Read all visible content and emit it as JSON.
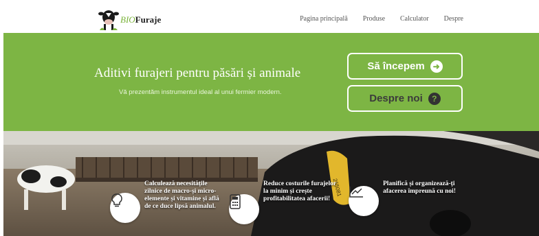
{
  "brand": {
    "bio": "BIO",
    "rest": "Furaje"
  },
  "nav": [
    "Pagina principală",
    "Produse",
    "Calculator",
    "Despre"
  ],
  "hero": {
    "title": "Aditivi furajeri pentru păsări și animale",
    "subtitle": "Vă prezentăm instrumentul ideal al unui fermier modern.",
    "btn_start": "Să începem",
    "btn_about": "Despre noi",
    "btn_start_icon": "arrow-right-icon",
    "btn_about_icon": "question-icon"
  },
  "features": [
    {
      "icon": "lightbulb-icon",
      "text": "Calculează necesitățile zilnice de macro-și micro-elemente și vitamine și află de ce duce lipsă animalul."
    },
    {
      "icon": "calculator-icon",
      "text": "Reduce costurile furajelor la minim și crește profitabilitatea afacerii!"
    },
    {
      "icon": "chart-line-icon",
      "text": "Planifică și organizează-ți afacerea împreună cu noi!"
    }
  ],
  "ear_tag": "265081",
  "colors": {
    "hero": "#7db544",
    "brand_green": "#7ab33a",
    "white": "#ffffff"
  }
}
